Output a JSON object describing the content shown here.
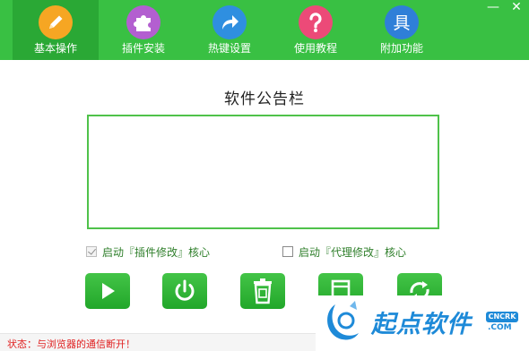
{
  "nav": {
    "tabs": [
      {
        "label": "基本操作",
        "icon": "pencil-icon",
        "color": "#f6a623"
      },
      {
        "label": "插件安装",
        "icon": "puzzle-icon",
        "color": "#b35fd0"
      },
      {
        "label": "热键设置",
        "icon": "share-arrow-icon",
        "color": "#2f8fe0"
      },
      {
        "label": "使用教程",
        "icon": "question-icon",
        "color": "#ec4a78"
      },
      {
        "label": "附加功能",
        "icon": "glyph-icon",
        "color": "#2f7fd8",
        "glyph": "具"
      }
    ],
    "active_index": 0
  },
  "window": {
    "minimize": "—",
    "close": "✕"
  },
  "notice": {
    "title": "软件公告栏"
  },
  "options": [
    {
      "label": "启动『插件修改』核心",
      "checked": true
    },
    {
      "label": "启动『代理修改』核心",
      "checked": false
    }
  ],
  "actions": [
    {
      "name": "start",
      "icon": "play-icon"
    },
    {
      "name": "power",
      "icon": "power-icon"
    },
    {
      "name": "clear",
      "icon": "trash-icon"
    },
    {
      "name": "extra",
      "icon": "window-icon"
    },
    {
      "name": "refresh",
      "icon": "refresh-icon"
    }
  ],
  "status": {
    "text": "状态：与浏览器的通信断开！"
  },
  "watermark": {
    "text": "起点软件",
    "badge": "CNCRK",
    "domain": ".COM"
  },
  "colors": {
    "primary": "#39c043",
    "active_tab": "#2aa835",
    "status_error": "#e02020",
    "accent_blue": "#1e8ad8"
  }
}
